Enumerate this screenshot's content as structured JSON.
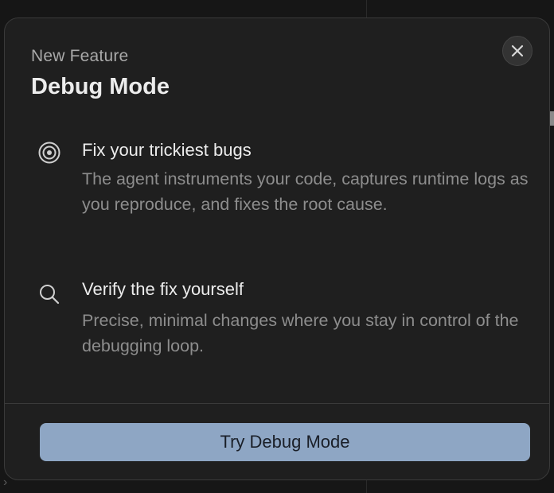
{
  "modal": {
    "eyebrow": "New Feature",
    "title": "Debug Mode",
    "close_icon": "close-icon"
  },
  "features": [
    {
      "icon": "target-icon",
      "title": "Fix your trickiest bugs",
      "description": "The agent instruments your code, captures runtime logs as you reproduce, and fixes the root cause."
    },
    {
      "icon": "search-icon",
      "title": "Verify the fix yourself",
      "description": "Precise, minimal changes where you stay in control of the debugging loop."
    }
  ],
  "cta": {
    "label": "Try Debug Mode"
  },
  "colors": {
    "modal_bg": "#1f1f1f",
    "cta_bg": "#8ea6c4",
    "title_text": "#ececec",
    "muted_text": "#8d8d8d"
  }
}
